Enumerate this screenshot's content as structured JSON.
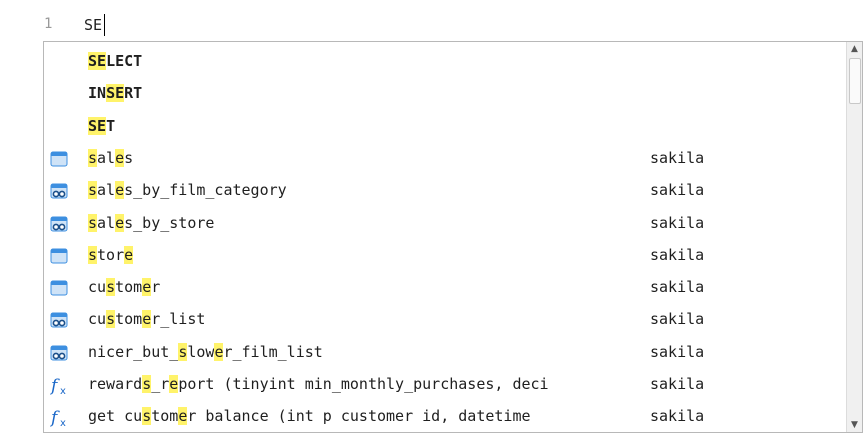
{
  "editor": {
    "line_number": "1",
    "text": "SE"
  },
  "autocomplete": {
    "items": [
      {
        "kind": "keyword",
        "icon": "none",
        "segments": [
          [
            "SE",
            true
          ],
          [
            "LECT",
            false
          ]
        ],
        "schema": ""
      },
      {
        "kind": "keyword",
        "icon": "none",
        "segments": [
          [
            "IN",
            false
          ],
          [
            "SE",
            true
          ],
          [
            "RT",
            false
          ]
        ],
        "schema": ""
      },
      {
        "kind": "keyword",
        "icon": "none",
        "segments": [
          [
            "SE",
            true
          ],
          [
            "T",
            false
          ]
        ],
        "schema": ""
      },
      {
        "kind": "table",
        "icon": "table-icon",
        "segments": [
          [
            "s",
            true
          ],
          [
            "al",
            false
          ],
          [
            "e",
            true
          ],
          [
            "s",
            false
          ]
        ],
        "schema": "sakila"
      },
      {
        "kind": "view",
        "icon": "view-icon",
        "segments": [
          [
            "s",
            true
          ],
          [
            "al",
            false
          ],
          [
            "e",
            true
          ],
          [
            "s_by_film_category",
            false
          ]
        ],
        "schema": "sakila"
      },
      {
        "kind": "view",
        "icon": "view-icon",
        "segments": [
          [
            "s",
            true
          ],
          [
            "al",
            false
          ],
          [
            "e",
            true
          ],
          [
            "s_by_store",
            false
          ]
        ],
        "schema": "sakila"
      },
      {
        "kind": "table",
        "icon": "table-icon",
        "segments": [
          [
            "s",
            true
          ],
          [
            "tor",
            false
          ],
          [
            "e",
            true
          ]
        ],
        "schema": "sakila"
      },
      {
        "kind": "table",
        "icon": "table-icon",
        "segments": [
          [
            "cu",
            false
          ],
          [
            "s",
            true
          ],
          [
            "tom",
            false
          ],
          [
            "e",
            true
          ],
          [
            "r",
            false
          ]
        ],
        "schema": "sakila"
      },
      {
        "kind": "view",
        "icon": "view-icon",
        "segments": [
          [
            "cu",
            false
          ],
          [
            "s",
            true
          ],
          [
            "tom",
            false
          ],
          [
            "e",
            true
          ],
          [
            "r_list",
            false
          ]
        ],
        "schema": "sakila"
      },
      {
        "kind": "view",
        "icon": "view-icon",
        "segments": [
          [
            "nicer_but_",
            false
          ],
          [
            "s",
            true
          ],
          [
            "low",
            false
          ],
          [
            "e",
            true
          ],
          [
            "r_film_list",
            false
          ]
        ],
        "schema": "sakila"
      },
      {
        "kind": "function",
        "icon": "function-icon",
        "segments": [
          [
            "reward",
            false
          ],
          [
            "s",
            true
          ],
          [
            "_r",
            false
          ],
          [
            "e",
            true
          ],
          [
            "port (tinyint min_monthly_purchases, deci",
            false
          ]
        ],
        "schema": "sakila"
      },
      {
        "kind": "function",
        "icon": "function-icon",
        "segments": [
          [
            "get cu",
            false
          ],
          [
            "s",
            true
          ],
          [
            "tom",
            false
          ],
          [
            "e",
            true
          ],
          [
            "r balance (int p customer id, datetime ",
            false
          ]
        ],
        "schema": "sakila"
      }
    ]
  },
  "scrollbar": {
    "up": "▲",
    "down": "▼"
  },
  "colors": {
    "highlight": "#fff36a",
    "table_icon": "#3d8fe0",
    "function_icon": "#1a67c8"
  }
}
